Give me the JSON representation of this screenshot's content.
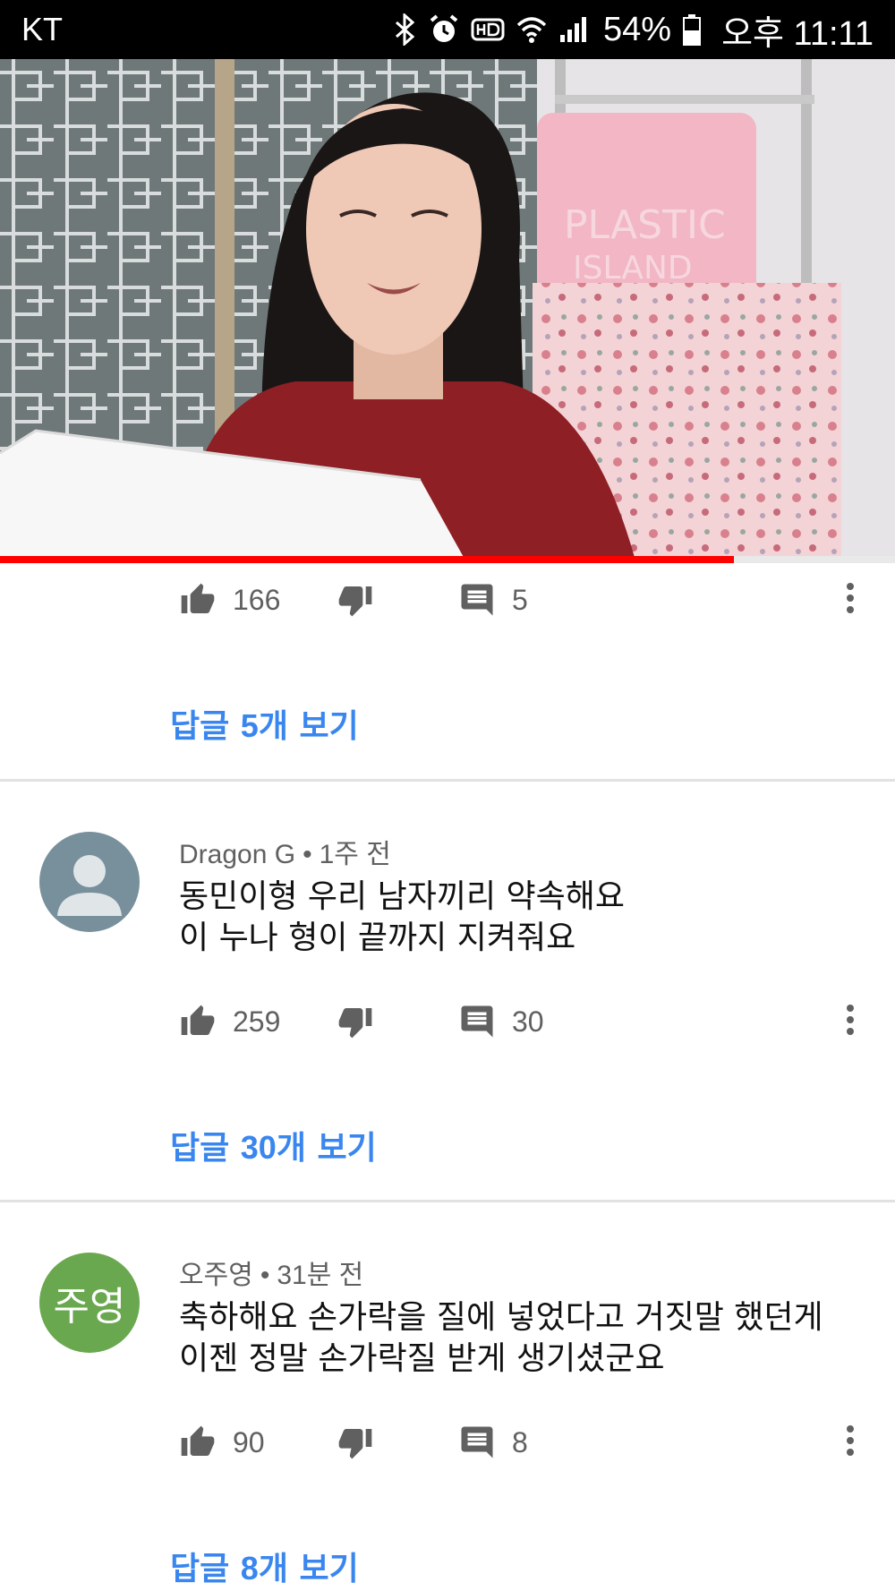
{
  "status_bar": {
    "carrier": "KT",
    "battery_percent": "54%",
    "time": "오후 11:11",
    "icons": [
      "bluetooth-icon",
      "alarm-icon",
      "hd-voice-icon",
      "wifi-icon",
      "signal-icon",
      "battery-icon"
    ]
  },
  "video": {
    "progress_fraction": 0.82,
    "progress_color": "#ff0000",
    "sign_text": "PLASTIC ISLAND"
  },
  "comments": [
    {
      "likes": "166",
      "reply_count": "5",
      "replies_link": {
        "prefix": "답글 ",
        "count": "5",
        "suffix": "개 보기"
      }
    },
    {
      "author": "Dragon G",
      "separator": "•",
      "time": "1주 전",
      "avatar": {
        "type": "default-person",
        "color": "#78909c"
      },
      "lines": [
        "동민이형 우리 남자끼리 약속해요",
        "이 누나 형이 끝까지 지켜줘요"
      ],
      "likes": "259",
      "reply_count": "30",
      "replies_link": {
        "prefix": "답글 ",
        "count": "30",
        "suffix": "개 보기"
      }
    },
    {
      "author": "오주영",
      "separator": "•",
      "time": "31분 전",
      "avatar": {
        "type": "initials",
        "text": "주영",
        "color": "#6aa84f"
      },
      "lines": [
        "축하해요 손가락을 질에 넣었다고 거짓말 했던게",
        "이젠 정말 손가락질 받게 생기셨군요"
      ],
      "likes": "90",
      "reply_count": "8",
      "replies_link": {
        "prefix": "답글 ",
        "count": "8",
        "suffix": "개 보기"
      }
    }
  ],
  "colors": {
    "link": "#3a86ef",
    "meta": "#606060",
    "divider": "#e2e2e2"
  }
}
